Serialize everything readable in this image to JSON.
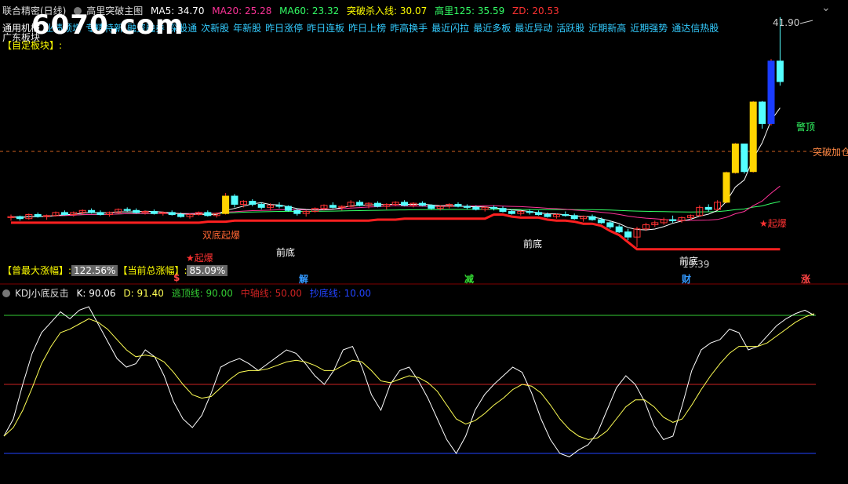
{
  "header": {
    "stock_name": "联合精密(日线)",
    "indicator_name": "高里突破主图",
    "ma5": "MA5: 34.70",
    "ma20": "MA20: 25.28",
    "ma60": "MA60: 23.32",
    "breakout_line": "突破杀入线: 30.07",
    "gaoli125": "高里125: 35.59",
    "zd": "ZD: 20.53"
  },
  "tabs": [
    "通用机械",
    "业绩预增",
    "专精特新",
    "融资融券",
    "深股通",
    "次新股",
    "年新股",
    "昨日涨停",
    "昨日连板",
    "昨日上榜",
    "昨高换手",
    "最近闪拉",
    "最近多板",
    "最近异动",
    "活跃股",
    "近期新高",
    "近期强势",
    "通达信热股"
  ],
  "region_label": "广东板块",
  "custom_block": "【自定板块】:",
  "watermark": "6070.com",
  "price_max_label": "41.90",
  "labels": {
    "breakout_add": "突破加仓",
    "top_warning": "警顶",
    "prev_bottom": "前底",
    "detonate": "★起爆",
    "double_bottom": "双底起爆",
    "low_price": "19.39"
  },
  "stats": {
    "max_gain_label": "【曾最大涨幅】:",
    "max_gain_value": "122.56%",
    "total_gain_label": "【当前总涨幅】:",
    "total_gain_value": "85.09%"
  },
  "events": [
    "$",
    "解",
    "减",
    "财",
    "涨"
  ],
  "kdj": {
    "title": "KDJ小底反击",
    "k": "K: 90.06",
    "d": "D: 91.40",
    "escape": "逃顶线: 90.00",
    "middle": "中轴线: 50.00",
    "bottom": "抄底线: 10.00"
  },
  "colors": {
    "up": "#ff3232",
    "down": "#54ffff",
    "ma5": "#ffffff",
    "ma20": "#ff3399",
    "ma60": "#33ff66",
    "breakout": "#ff2020",
    "kdj_k": "#ffffff",
    "kdj_d": "#ffff55",
    "escape_line": "#33cc33",
    "middle_line": "#cc2222",
    "bottom_line": "#2244ff"
  },
  "chart_data": [
    {
      "type": "candlestick",
      "title": "高里突破主图",
      "ylim": [
        17.5,
        42.5
      ],
      "candles": [
        [
          22.3,
          22.6,
          22.0,
          22.4
        ],
        [
          22.4,
          22.5,
          22.0,
          22.2
        ],
        [
          22.2,
          22.7,
          22.1,
          22.6
        ],
        [
          22.6,
          22.8,
          22.3,
          22.4
        ],
        [
          22.4,
          22.6,
          22.1,
          22.5
        ],
        [
          22.5,
          22.9,
          22.4,
          22.8
        ],
        [
          22.8,
          23.0,
          22.5,
          22.6
        ],
        [
          22.6,
          22.9,
          22.4,
          22.8
        ],
        [
          22.8,
          23.1,
          22.6,
          23.0
        ],
        [
          23.0,
          23.2,
          22.7,
          22.8
        ],
        [
          22.8,
          23.0,
          22.5,
          22.6
        ],
        [
          22.6,
          22.9,
          22.4,
          22.8
        ],
        [
          22.8,
          23.2,
          22.7,
          23.1
        ],
        [
          23.1,
          23.3,
          22.9,
          23.0
        ],
        [
          23.0,
          23.2,
          22.7,
          22.8
        ],
        [
          22.8,
          23.0,
          22.6,
          22.9
        ],
        [
          22.9,
          23.1,
          22.6,
          22.7
        ],
        [
          22.7,
          22.9,
          22.5,
          22.8
        ],
        [
          22.8,
          23.0,
          22.5,
          22.6
        ],
        [
          22.6,
          22.8,
          22.3,
          22.4
        ],
        [
          22.4,
          22.7,
          22.2,
          22.6
        ],
        [
          22.6,
          22.9,
          22.5,
          22.8
        ],
        [
          22.8,
          23.0,
          22.4,
          22.5
        ],
        [
          22.5,
          22.8,
          22.3,
          22.7
        ],
        [
          22.7,
          24.7,
          22.6,
          24.4
        ],
        [
          24.4,
          24.6,
          23.3,
          23.6
        ],
        [
          23.6,
          24.0,
          23.3,
          23.9
        ],
        [
          23.9,
          24.1,
          23.4,
          23.6
        ],
        [
          23.6,
          23.8,
          23.1,
          23.3
        ],
        [
          23.3,
          23.7,
          23.0,
          23.5
        ],
        [
          23.5,
          23.8,
          23.2,
          23.4
        ],
        [
          23.4,
          23.5,
          22.9,
          23.0
        ],
        [
          23.0,
          23.2,
          22.5,
          22.7
        ],
        [
          22.7,
          23.0,
          22.4,
          22.9
        ],
        [
          22.9,
          23.3,
          22.8,
          23.2
        ],
        [
          23.2,
          23.6,
          23.0,
          23.5
        ],
        [
          23.5,
          23.8,
          23.2,
          23.3
        ],
        [
          23.3,
          23.5,
          23.0,
          23.4
        ],
        [
          23.4,
          24.0,
          23.3,
          23.8
        ],
        [
          23.8,
          24.0,
          23.4,
          23.5
        ],
        [
          23.5,
          23.8,
          23.2,
          23.7
        ],
        [
          23.7,
          23.9,
          23.3,
          23.4
        ],
        [
          23.4,
          23.7,
          23.1,
          23.6
        ],
        [
          23.6,
          23.9,
          23.4,
          23.8
        ],
        [
          23.8,
          24.0,
          23.4,
          23.5
        ],
        [
          23.5,
          23.8,
          23.3,
          23.7
        ],
        [
          23.7,
          23.9,
          23.4,
          23.5
        ],
        [
          23.5,
          23.6,
          23.1,
          23.2
        ],
        [
          23.2,
          23.5,
          23.0,
          23.4
        ],
        [
          23.4,
          23.7,
          23.2,
          23.6
        ],
        [
          23.6,
          23.8,
          23.3,
          23.4
        ],
        [
          23.4,
          23.6,
          23.1,
          23.3
        ],
        [
          23.3,
          23.5,
          23.0,
          23.1
        ],
        [
          23.1,
          23.4,
          22.9,
          23.3
        ],
        [
          23.3,
          23.5,
          23.0,
          23.2
        ],
        [
          23.2,
          23.4,
          22.8,
          22.9
        ],
        [
          22.9,
          23.1,
          22.6,
          22.7
        ],
        [
          22.7,
          23.0,
          22.5,
          22.9
        ],
        [
          22.9,
          23.1,
          22.6,
          22.8
        ],
        [
          22.8,
          23.0,
          22.5,
          22.6
        ],
        [
          22.6,
          22.8,
          22.3,
          22.4
        ],
        [
          22.4,
          22.7,
          22.2,
          22.6
        ],
        [
          22.6,
          22.9,
          22.4,
          22.5
        ],
        [
          22.5,
          22.7,
          22.1,
          22.2
        ],
        [
          22.2,
          22.5,
          21.9,
          22.4
        ],
        [
          22.4,
          22.6,
          22.0,
          22.1
        ],
        [
          22.1,
          22.3,
          21.7,
          21.8
        ],
        [
          21.8,
          22.0,
          21.2,
          21.4
        ],
        [
          21.4,
          21.6,
          20.8,
          20.9
        ],
        [
          20.9,
          21.2,
          20.1,
          20.4
        ],
        [
          20.4,
          21.4,
          19.4,
          21.2
        ],
        [
          21.2,
          21.8,
          21.0,
          21.6
        ],
        [
          21.6,
          22.0,
          21.4,
          21.8
        ],
        [
          21.8,
          22.3,
          21.6,
          22.1
        ],
        [
          22.1,
          22.5,
          21.8,
          22.0
        ],
        [
          22.0,
          22.4,
          21.8,
          22.3
        ],
        [
          22.3,
          22.6,
          22.1,
          22.5
        ],
        [
          22.5,
          23.5,
          22.4,
          23.3
        ],
        [
          23.3,
          23.6,
          22.9,
          23.1
        ],
        [
          23.1,
          24.0,
          23.0,
          23.8
        ],
        [
          23.8,
          26.8,
          23.7,
          26.7
        ],
        [
          26.7,
          29.6,
          26.6,
          29.5
        ],
        [
          29.5,
          26.8,
          26.6,
          26.8
        ],
        [
          26.8,
          33.7,
          26.7,
          33.6
        ],
        [
          33.6,
          33.7,
          31.0,
          31.5
        ],
        [
          31.5,
          37.8,
          31.3,
          37.6
        ],
        [
          37.6,
          41.9,
          35.2,
          35.6
        ]
      ],
      "ma20_value": 25.28,
      "ma60_value": 23.32,
      "breakout_value": 30.07
    },
    {
      "type": "line",
      "title": "KDJ小底反击",
      "ylim": [
        0,
        100
      ],
      "hlines": [
        90,
        50,
        10
      ],
      "series": [
        {
          "name": "K",
          "values": [
            20,
            30,
            50,
            68,
            80,
            86,
            92,
            88,
            93,
            95,
            85,
            75,
            65,
            60,
            62,
            70,
            66,
            55,
            40,
            30,
            25,
            32,
            45,
            60,
            63,
            65,
            62,
            58,
            62,
            66,
            70,
            68,
            62,
            55,
            50,
            58,
            70,
            72,
            60,
            44,
            35,
            50,
            58,
            60,
            52,
            42,
            30,
            18,
            10,
            20,
            35,
            44,
            50,
            55,
            60,
            57,
            45,
            30,
            18,
            10,
            8,
            12,
            15,
            22,
            35,
            48,
            55,
            50,
            40,
            26,
            18,
            20,
            38,
            58,
            70,
            74,
            76,
            82,
            80,
            70,
            72,
            78,
            84,
            88,
            91,
            93,
            90
          ]
        },
        {
          "name": "D",
          "values": [
            20,
            25,
            35,
            48,
            62,
            72,
            80,
            82,
            85,
            88,
            86,
            82,
            76,
            70,
            66,
            67,
            66,
            63,
            57,
            50,
            44,
            42,
            43,
            48,
            53,
            57,
            58,
            58,
            59,
            61,
            63,
            64,
            63,
            61,
            58,
            58,
            61,
            64,
            63,
            58,
            52,
            51,
            53,
            55,
            54,
            51,
            46,
            38,
            30,
            27,
            29,
            33,
            38,
            42,
            47,
            50,
            49,
            45,
            38,
            30,
            24,
            20,
            18,
            19,
            23,
            30,
            37,
            41,
            41,
            37,
            31,
            28,
            30,
            38,
            47,
            55,
            62,
            68,
            72,
            72,
            72,
            74,
            78,
            82,
            86,
            89,
            91
          ]
        }
      ]
    }
  ]
}
